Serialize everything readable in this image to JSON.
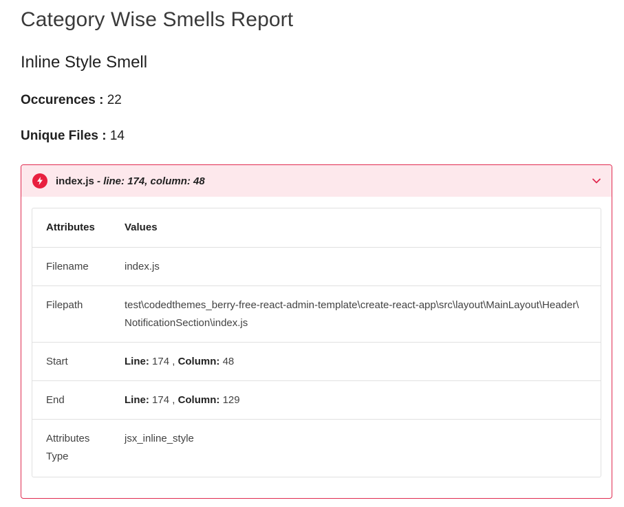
{
  "report": {
    "title": "Category Wise Smells Report",
    "smell_title": "Inline Style Smell",
    "occurrences_label": "Occurences :",
    "occurrences_value": "22",
    "unique_files_label": "Unique Files :",
    "unique_files_value": "14"
  },
  "accordion": {
    "file": "index.js",
    "location": " - line: 174, column: 48",
    "icon": "bolt-icon",
    "expand_icon": "chevron-down-icon",
    "expanded": true,
    "accent_color": "#e0294f",
    "header_bg": "#fde8ec"
  },
  "table": {
    "headers": [
      "Attributes",
      "Values"
    ],
    "filename_label": "Filename",
    "filename_value": "index.js",
    "filepath_label": "Filepath",
    "filepath_value": "test\\codedthemes_berry-free-react-admin-template\\create-react-app\\src\\layout\\MainLayout\\Header\\NotificationSection\\index.js",
    "start_label": "Start",
    "start_line_label": "Line:",
    "start_line_value": "174",
    "start_sep": ",",
    "start_column_label": "Column:",
    "start_column_value": "48",
    "end_label": "End",
    "end_line_label": "Line:",
    "end_line_value": "174",
    "end_sep": ",",
    "end_column_label": "Column:",
    "end_column_value": "129",
    "type_label": "Attributes Type",
    "type_value": "jsx_inline_style"
  }
}
